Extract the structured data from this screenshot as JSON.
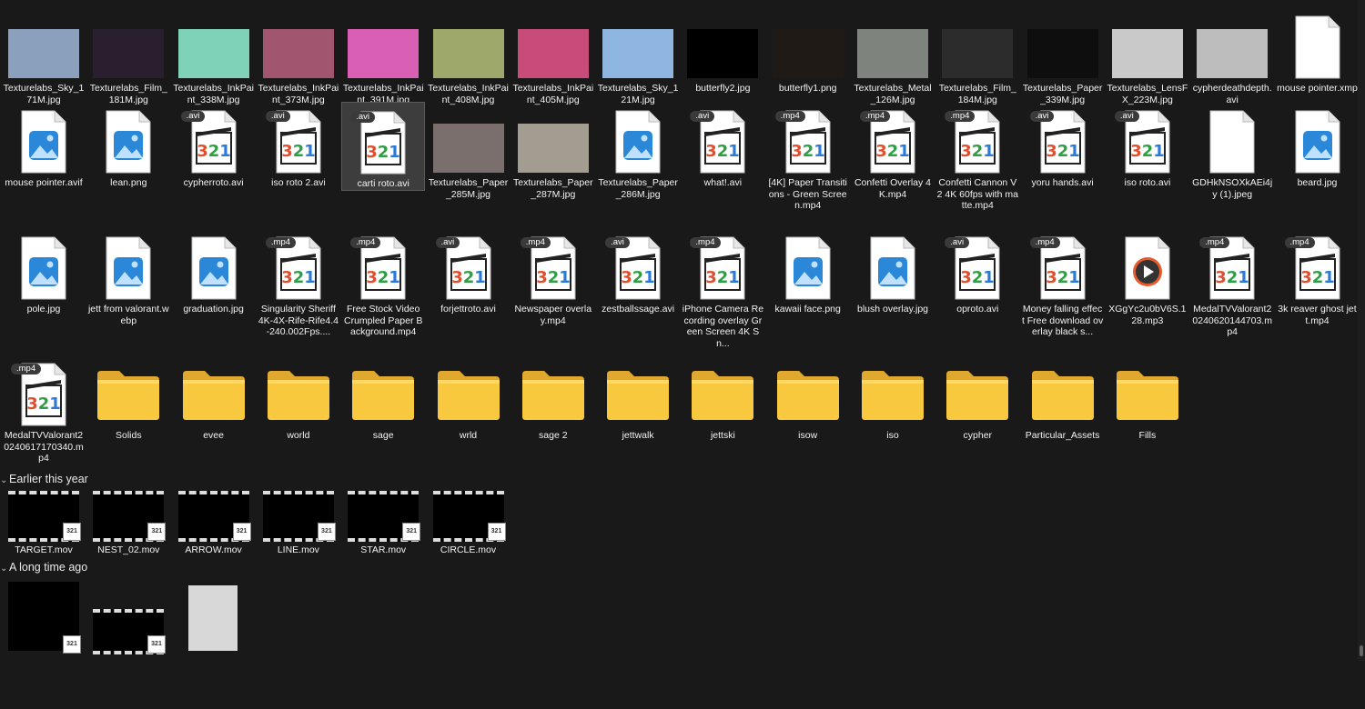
{
  "row1": [
    {
      "name": "Texturelabs_Sky_171M.jpg",
      "kind": "img",
      "color": "#8aa0bd"
    },
    {
      "name": "Texturelabs_Film_181M.jpg",
      "kind": "img",
      "color": "#2a1f2e"
    },
    {
      "name": "Texturelabs_InkPaint_338M.jpg",
      "kind": "img",
      "color": "#7fd1b8"
    },
    {
      "name": "Texturelabs_InkPaint_373M.jpg",
      "kind": "img",
      "color": "#a2556f"
    },
    {
      "name": "Texturelabs_InkPaint_391M.jpg",
      "kind": "img",
      "color": "#d85fb3"
    },
    {
      "name": "Texturelabs_InkPaint_408M.jpg",
      "kind": "img",
      "color": "#9ea86a"
    },
    {
      "name": "Texturelabs_InkPaint_405M.jpg",
      "kind": "img",
      "color": "#c84c7a"
    },
    {
      "name": "Texturelabs_Sky_121M.jpg",
      "kind": "img",
      "color": "#8fb6e0"
    },
    {
      "name": "butterfly2.jpg",
      "kind": "img",
      "color": "#000000"
    },
    {
      "name": "butterfly1.png",
      "kind": "img",
      "color": "#1f1a15"
    },
    {
      "name": "Texturelabs_Metal_126M.jpg",
      "kind": "img",
      "color": "#7e837d"
    },
    {
      "name": "Texturelabs_Film_184M.jpg",
      "kind": "img",
      "color": "#2c2c2c"
    },
    {
      "name": "Texturelabs_Paper_339M.jpg",
      "kind": "img",
      "color": "#0e0e0e"
    },
    {
      "name": "Texturelabs_LensFX_223M.jpg",
      "kind": "img",
      "color": "#c9c9c9"
    },
    {
      "name": "cypherdeathdepth.avi",
      "kind": "img",
      "color": "#bdbdbd"
    },
    {
      "name": "mouse pointer.xmp",
      "kind": "blank"
    }
  ],
  "row2": [
    {
      "name": "mouse pointer.avif",
      "kind": "photo"
    },
    {
      "name": "lean.png",
      "kind": "photo"
    },
    {
      "name": "cypherroto.avi",
      "kind": "vid",
      "ext": ".avi"
    },
    {
      "name": "iso roto 2.avi",
      "kind": "vid",
      "ext": ".avi"
    },
    {
      "name": "carti roto.avi",
      "kind": "vid",
      "ext": ".avi",
      "selected": true
    },
    {
      "name": "Texturelabs_Paper_285M.jpg",
      "kind": "img",
      "color": "#7a6f6c"
    },
    {
      "name": "Texturelabs_Paper_287M.jpg",
      "kind": "img",
      "color": "#a39c90"
    },
    {
      "name": "Texturelabs_Paper_286M.jpg",
      "kind": "photo"
    },
    {
      "name": "what!.avi",
      "kind": "vid",
      "ext": ".avi"
    },
    {
      "name": "[4K] Paper Transitions - Green Screen.mp4",
      "kind": "vid",
      "ext": ".mp4"
    },
    {
      "name": "Confetti Overlay 4K.mp4",
      "kind": "vid",
      "ext": ".mp4"
    },
    {
      "name": "Confetti Cannon V2 4K 60fps with matte.mp4",
      "kind": "vid",
      "ext": ".mp4"
    },
    {
      "name": "yoru hands.avi",
      "kind": "vid",
      "ext": ".avi"
    },
    {
      "name": "iso roto.avi",
      "kind": "vid",
      "ext": ".avi"
    },
    {
      "name": "GDHkNSOXkAEi4jy (1).jpeg",
      "kind": "blank"
    },
    {
      "name": "beard.jpg",
      "kind": "photo"
    }
  ],
  "row3": [
    {
      "name": "pole.jpg",
      "kind": "photo"
    },
    {
      "name": "jett from valorant.webp",
      "kind": "photo"
    },
    {
      "name": "graduation.jpg",
      "kind": "photo"
    },
    {
      "name": "Singularity Sheriff 4K-4X-Rife-Rife4.4-240.002Fps....",
      "kind": "vid",
      "ext": ".mp4"
    },
    {
      "name": "Free Stock Video Crumpled Paper Background.mp4",
      "kind": "vid",
      "ext": ".mp4"
    },
    {
      "name": "forjettroto.avi",
      "kind": "vid",
      "ext": ".avi"
    },
    {
      "name": "Newspaper overlay.mp4",
      "kind": "vid",
      "ext": ".mp4"
    },
    {
      "name": "zestballssage.avi",
      "kind": "vid",
      "ext": ".avi"
    },
    {
      "name": "iPhone Camera Recording overlay Green Screen 4K   Sn...",
      "kind": "vid",
      "ext": ".mp4"
    },
    {
      "name": "kawaii face.png",
      "kind": "photo"
    },
    {
      "name": "blush overlay.jpg",
      "kind": "photo"
    },
    {
      "name": "oproto.avi",
      "kind": "vid",
      "ext": ".avi"
    },
    {
      "name": "Money falling effect Free download overlay black s...",
      "kind": "vid",
      "ext": ".mp4"
    },
    {
      "name": "XGgYc2u0bV6S.128.mp3",
      "kind": "audio"
    },
    {
      "name": "MedalTVValorant20240620144703.mp4",
      "kind": "vid",
      "ext": ".mp4"
    },
    {
      "name": "3k reaver ghost jett.mp4",
      "kind": "vid",
      "ext": ".mp4"
    }
  ],
  "row4": [
    {
      "name": "MedalTVValorant20240617170340.mp4",
      "kind": "vid",
      "ext": ".mp4"
    },
    {
      "name": "Solids",
      "kind": "folder"
    },
    {
      "name": "evee",
      "kind": "folder"
    },
    {
      "name": "world",
      "kind": "folder"
    },
    {
      "name": "sage",
      "kind": "folder"
    },
    {
      "name": "wrld",
      "kind": "folder"
    },
    {
      "name": "sage 2",
      "kind": "folder"
    },
    {
      "name": "jettwalk",
      "kind": "folder"
    },
    {
      "name": "jettski",
      "kind": "folder"
    },
    {
      "name": "isow",
      "kind": "folder"
    },
    {
      "name": "iso",
      "kind": "folder"
    },
    {
      "name": "cypher",
      "kind": "folder"
    },
    {
      "name": "Particular_Assets",
      "kind": "folder"
    },
    {
      "name": "Fills",
      "kind": "folder"
    }
  ],
  "section_earlier": "Earlier this year",
  "earlier": [
    {
      "name": "TARGET.mov"
    },
    {
      "name": "NEST_02.mov"
    },
    {
      "name": "ARROW.mov"
    },
    {
      "name": "LINE.mov"
    },
    {
      "name": "STAR.mov"
    },
    {
      "name": "CIRCLE.mov"
    }
  ],
  "section_longago": "A long time ago",
  "badge_text": "321",
  "colors": {
    "background": "#191919",
    "folder": "#f8c83e",
    "photo_icon": "#2b88d8"
  }
}
